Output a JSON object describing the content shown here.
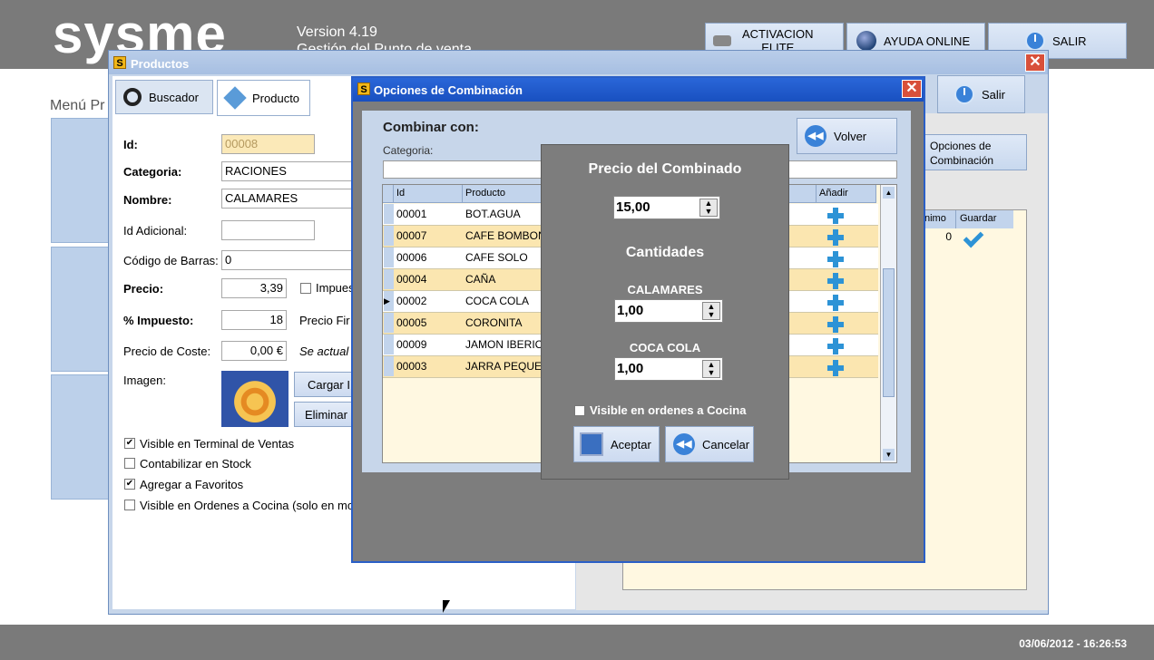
{
  "app": {
    "logo": "sysme",
    "version": "Version 4.19",
    "subtitle": "Gestión del Punto de venta",
    "menu_label": "Menú Pr",
    "datetime": "03/06/2012 - 16:26:53"
  },
  "top_buttons": {
    "activacion_line1": "ACTIVACION",
    "activacion_line2": "ELITE",
    "ayuda": "AYUDA ONLINE",
    "salir": "SALIR"
  },
  "productos": {
    "title": "Productos",
    "close": "✕",
    "tab_buscador": "Buscador",
    "tab_producto": "Producto",
    "fields": {
      "id_label": "Id:",
      "id_value": "00008",
      "categoria_label": "Categoria:",
      "categoria_value": "RACIONES",
      "nombre_label": "Nombre:",
      "nombre_value": "CALAMARES",
      "id_adicional_label": "Id Adicional:",
      "id_adicional_value": "",
      "codigo_label": "Código de Barras:",
      "codigo_value": "0",
      "precio_label": "Precio:",
      "precio_value": "3,39",
      "impuesto_chk_label": "Impues",
      "pct_impuesto_label": "% Impuesto:",
      "pct_impuesto_value": "18",
      "precio_final_label": "Precio Fir",
      "coste_label": "Precio de Coste:",
      "coste_value": "0,00 €",
      "se_actual": "Se actual",
      "imagen_label": "Imagen:",
      "cargar": "Cargar I",
      "eliminar": "Eliminar"
    },
    "checks": [
      {
        "label": "Visible en Terminal de Ventas",
        "checked": "✔"
      },
      {
        "label": "Contabilizar en Stock",
        "checked": ""
      },
      {
        "label": "Agregar a Favoritos",
        "checked": "✔"
      },
      {
        "label": "Visible en Ordenes a Cocina (solo en mo",
        "checked": ""
      }
    ],
    "salir": "Salir",
    "opciones_line1": "Opciones de",
    "opciones_line2": "Combinación",
    "right_grid": {
      "col1": "nimo",
      "col2": "Guardar",
      "val": "0"
    }
  },
  "opciones": {
    "title": "Opciones de Combinación",
    "close": "✕",
    "combinar_con": "Combinar con:",
    "categoria_label": "Categoria:",
    "volver": "Volver",
    "grid_headers": {
      "id": "Id",
      "producto": "Producto",
      "anadir": "Añadir"
    },
    "rows": [
      {
        "id": "00001",
        "producto": "BOT.AGUA",
        "selected": ""
      },
      {
        "id": "00007",
        "producto": "CAFE BOMBON",
        "selected": ""
      },
      {
        "id": "00006",
        "producto": "CAFE SOLO",
        "selected": ""
      },
      {
        "id": "00004",
        "producto": "CAÑA",
        "selected": ""
      },
      {
        "id": "00002",
        "producto": "COCA COLA",
        "selected": "▶"
      },
      {
        "id": "00005",
        "producto": "CORONITA",
        "selected": ""
      },
      {
        "id": "00009",
        "producto": "JAMON IBERIC",
        "selected": ""
      },
      {
        "id": "00003",
        "producto": "JARRA PEQUE",
        "selected": ""
      }
    ],
    "precio_combinado_label": "Precio del Combinado",
    "precio_combinado_value": "15,00",
    "cantidades_label": "Cantidades",
    "item1_label": "CALAMARES",
    "item1_value": "1,00",
    "item2_label": "COCA COLA",
    "item2_value": "1,00",
    "visible_cocina": "Visible en ordenes a Cocina",
    "aceptar": "Aceptar",
    "cancelar": "Cancelar"
  }
}
